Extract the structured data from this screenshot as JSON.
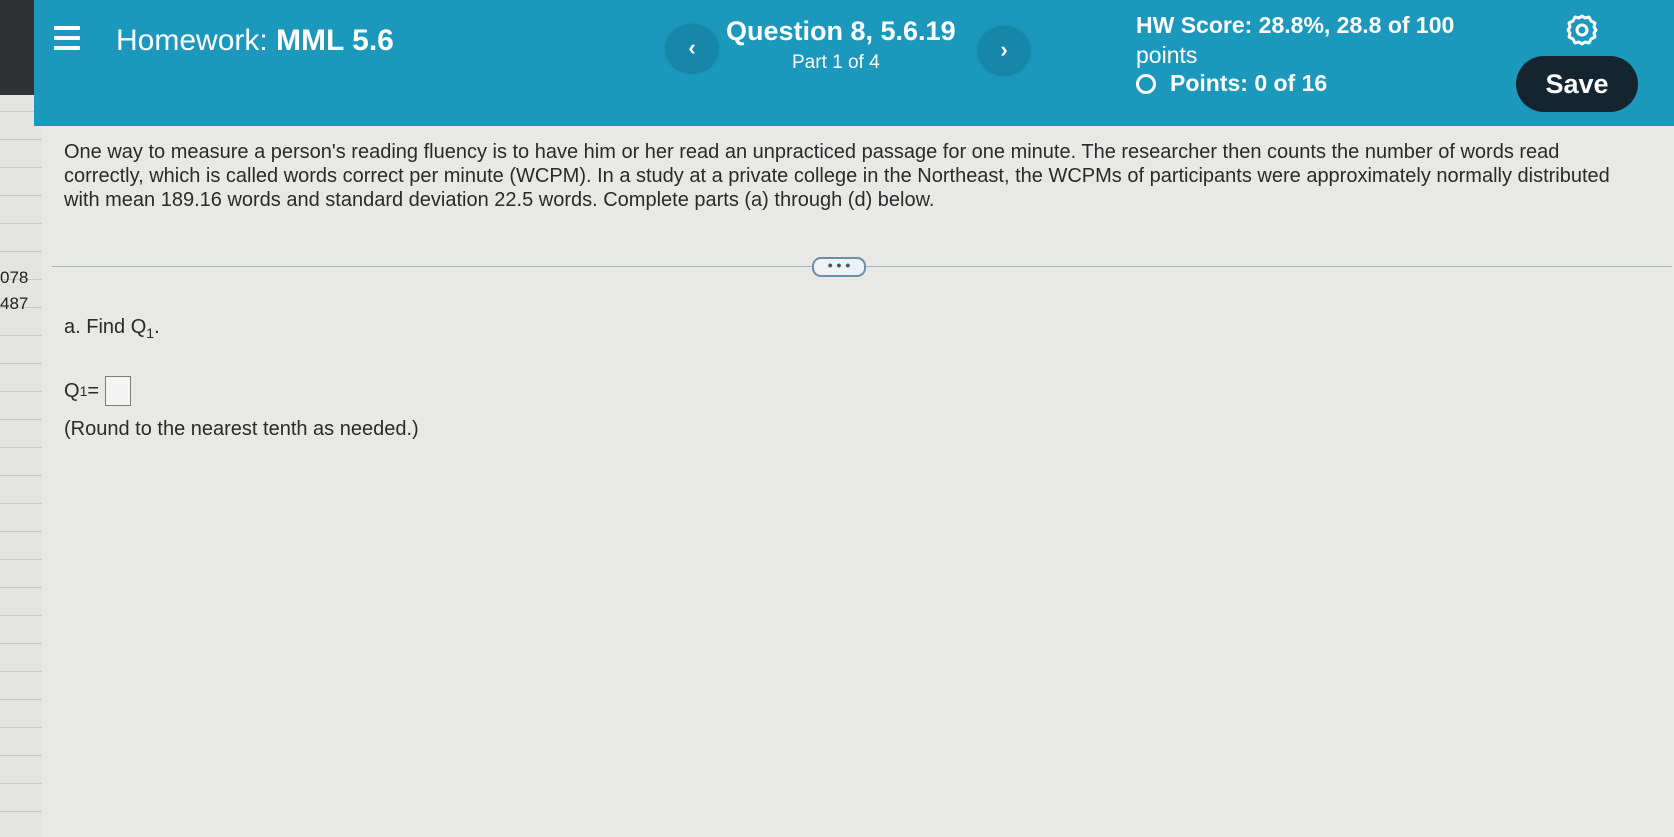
{
  "background_sheet": {
    "row_numbers": [
      "078",
      "487"
    ]
  },
  "header": {
    "menu_icon": "hamburger-menu-icon",
    "homework_prefix": "Homework:",
    "homework_name": "MML 5.6",
    "prev_glyph": "‹",
    "next_glyph": "›",
    "question_title": "Question 8, 5.6.19",
    "question_part": "Part 1 of 4",
    "hw_score_line": "HW Score: 28.8%, 28.8 of 100",
    "hw_score_unit": "points",
    "points": "Points: 0 of 16",
    "settings_icon": "gear-icon",
    "save_label": "Save",
    "accent_color": "#1c98bd",
    "save_color": "#15252f"
  },
  "problem": {
    "text": "One way to measure a person's reading fluency is to have him or her read an unpracticed passage for one minute. The researcher then counts the number of words read correctly, which is called words correct per minute (WCPM). In a study at a private college in the Northeast, the WCPMs of participants were approximately normally distributed with mean 189.16 words and standard deviation 22.5 words. Complete parts (a) through (d) below.",
    "more_label": "• • •"
  },
  "part_a": {
    "prompt_prefix": "a. Find Q",
    "prompt_sub": "1",
    "prompt_suffix": ".",
    "answer_label_prefix": "Q",
    "answer_label_sub": "1",
    "answer_label_suffix": " =",
    "answer_value": "",
    "note": "(Round to the nearest tenth as needed.)"
  }
}
